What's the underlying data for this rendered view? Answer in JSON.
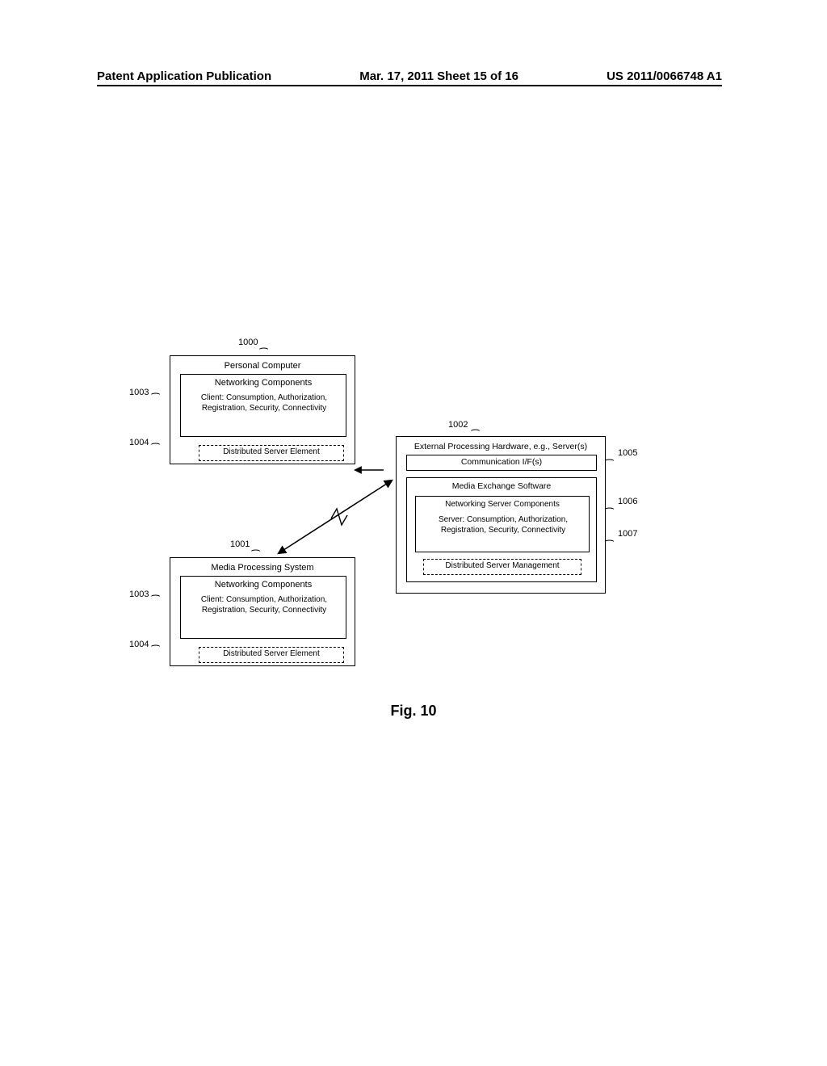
{
  "header": {
    "left": "Patent Application Publication",
    "mid": "Mar. 17, 2011  Sheet 15 of 16",
    "right": "US 2011/0066748 A1"
  },
  "refs": {
    "r1000": "1000",
    "r1001": "1001",
    "r1002": "1002",
    "r1003a": "1003",
    "r1003b": "1003",
    "r1004a": "1004",
    "r1004b": "1004",
    "r1005": "1005",
    "r1006": "1006",
    "r1007": "1007"
  },
  "boxes": {
    "pc_title": "Personal Computer",
    "nc1": "Networking Components",
    "client1": "Client: Consumption, Authorization, Registration, Security, Connectivity",
    "dse1": "Distributed Server Element",
    "mps_title": "Media Processing System",
    "nc2": "Networking Components",
    "client2": "Client: Consumption, Authorization, Registration, Security, Connectivity",
    "dse2": "Distributed Server Element",
    "eph_title": "External Processing Hardware, e.g., Server(s)",
    "comm_if": "Communication I/F(s)",
    "mes_title": "Media Exchange Software",
    "nsc": "Networking Server Components",
    "server_desc": "Server: Consumption, Authorization, Registration, Security, Connectivity",
    "dsm": "Distributed Server Management"
  },
  "caption": "Fig. 10"
}
